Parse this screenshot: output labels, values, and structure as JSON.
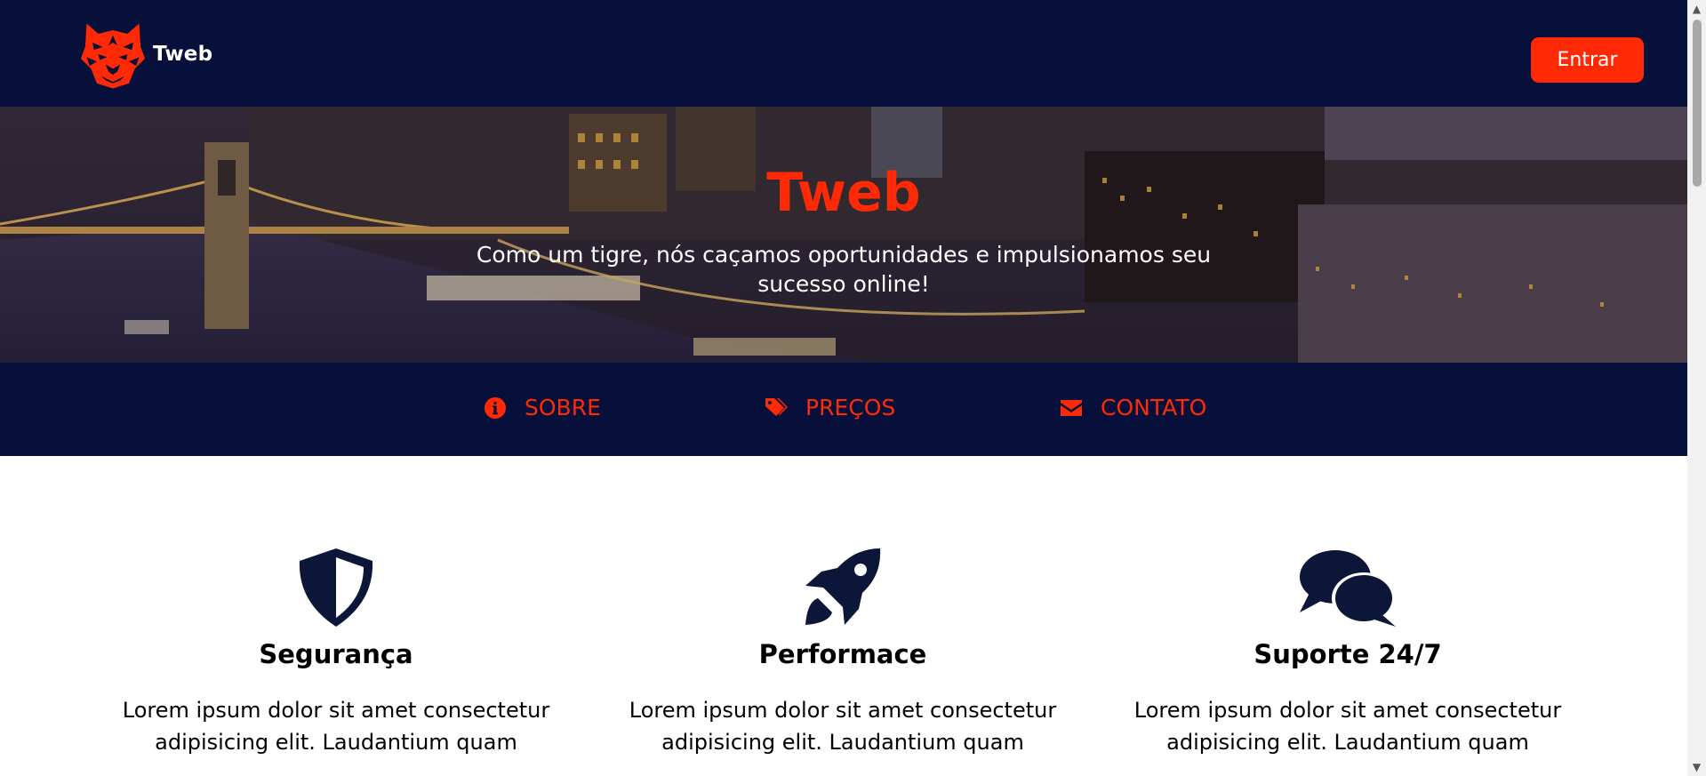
{
  "app": {
    "brand_name": "Tweb",
    "accent_color": "#ff2a05",
    "navy_color": "#07103a"
  },
  "header": {
    "logo_icon": "tiger-head-icon",
    "brand_label": "Tweb",
    "login_label": "Entrar"
  },
  "hero": {
    "title": "Tweb",
    "subtitle": "Como um tigre, nós caçamos oportunidades e impulsionamos seu sucesso online!"
  },
  "nav": {
    "items": [
      {
        "label": "SOBRE",
        "icon": "info-circle-icon"
      },
      {
        "label": "PREÇOS",
        "icon": "tags-icon"
      },
      {
        "label": "CONTATO",
        "icon": "envelope-icon"
      }
    ]
  },
  "features": [
    {
      "icon": "shield-icon",
      "title": "Segurança",
      "text": "Lorem ipsum dolor sit amet consectetur adipisicing elit. Laudantium quam"
    },
    {
      "icon": "rocket-icon",
      "title": "Performace",
      "text": "Lorem ipsum dolor sit amet consectetur adipisicing elit. Laudantium quam"
    },
    {
      "icon": "chat-bubbles-icon",
      "title": "Suporte 24/7",
      "text": "Lorem ipsum dolor sit amet consectetur adipisicing elit. Laudantium quam"
    }
  ]
}
